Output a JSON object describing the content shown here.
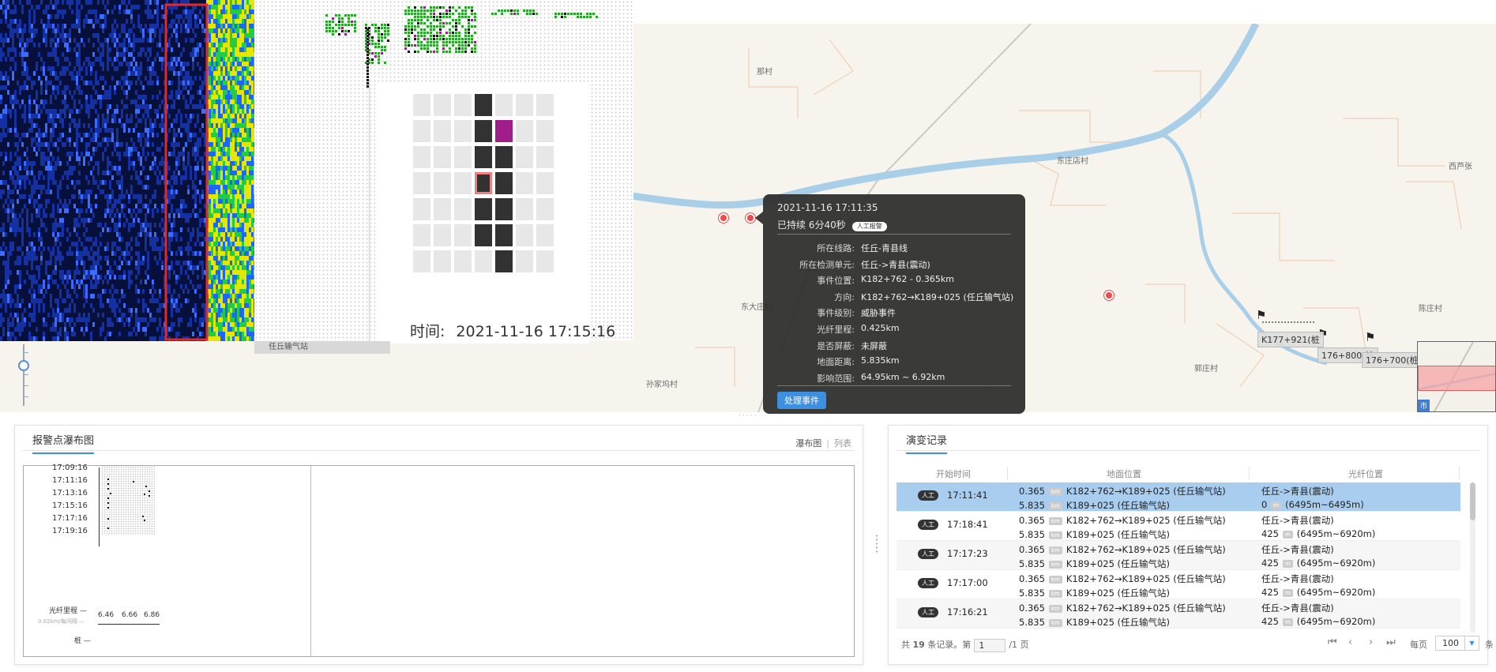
{
  "map": {
    "villages": [
      {
        "name": "那村"
      },
      {
        "name": "东庄店村"
      },
      {
        "name": "西芦张"
      },
      {
        "name": "东大庄村"
      },
      {
        "name": "陈庄村"
      },
      {
        "name": "郭庄村"
      },
      {
        "name": "孙家坞村"
      }
    ],
    "pile_labels": [
      "K177+921(桩",
      "176+800(桩",
      "176+700(桩"
    ],
    "peek_tag": "任丘输气站",
    "minimap_tag": "市",
    "zoom_in": "+",
    "zoom_out": "−",
    "colors": {
      "road": "#c8c6c1",
      "river": "#a9cfe8",
      "alarm": "#ee4b4b",
      "background": "#f7f4ee"
    }
  },
  "zoom_panel": {
    "time_label": "时间:",
    "time_value": "2021-11-16 17:15:16",
    "colors": {
      "dark": "#323232",
      "highlight": "#a01e8a",
      "selected_outline": "#f08080",
      "empty": "#e7e7e7"
    }
  },
  "popup": {
    "time": "2021-11-16 17:11:35",
    "duration": "已持续 6分40秒",
    "pill": "人工报警",
    "fields": [
      {
        "k": "所在线路:",
        "v": "任丘-青县线"
      },
      {
        "k": "所在检测单元:",
        "v": "任丘->青县(震动)"
      },
      {
        "k": "事件位置:",
        "v": "K182+762 - 0.365km"
      },
      {
        "k": "方向:",
        "v": "K182+762→K189+025 (任丘输气站)"
      },
      {
        "k": "事件级别:",
        "v": "威胁事件"
      },
      {
        "k": "光纤里程:",
        "v": "0.425km"
      },
      {
        "k": "是否屏蔽:",
        "v": "未屏蔽"
      },
      {
        "k": "地面距离:",
        "v": "5.835km"
      },
      {
        "k": "影响范围:",
        "v": "64.95km ~ 6.92km"
      }
    ],
    "button": "处理事件"
  },
  "left_panel": {
    "title": "报警点瀑布图",
    "view_waterfall": "瀑布图",
    "view_list": "列表",
    "time_ticks": [
      "17:09:16",
      "17:11:16",
      "17:13:16",
      "17:15:16",
      "17:17:16",
      "17:19:16"
    ],
    "fiber_label": "光纤里程 —",
    "fiber_unit": "0.02km/每间隔 —",
    "fiber_ticks": [
      "6.46",
      "6.66",
      "6.86"
    ],
    "base_label": "桩 —"
  },
  "right_panel": {
    "title": "演变记录",
    "columns": [
      "开始时间",
      "地面位置",
      "光纤位置"
    ],
    "rows": [
      {
        "badge": "人工",
        "time": "17:11:41",
        "g_km": "0.365",
        "g_unit": "km",
        "g_route": "K182+762→K189+025 (任丘输气站)",
        "g2_km": "5.835",
        "g2_unit": "km",
        "g2_route": "K189+025 (任丘输气站)",
        "f_unit_name": "任丘->青县(震动)",
        "f_m": "0",
        "f_unit": "m",
        "f_range": "(6495m~6495m)"
      },
      {
        "badge": "人工",
        "time": "17:18:41",
        "g_km": "0.365",
        "g_unit": "km",
        "g_route": "K182+762→K189+025 (任丘输气站)",
        "g2_km": "5.835",
        "g2_unit": "km",
        "g2_route": "K189+025 (任丘输气站)",
        "f_unit_name": "任丘->青县(震动)",
        "f_m": "425",
        "f_unit": "m",
        "f_range": "(6495m~6920m)"
      },
      {
        "badge": "人工",
        "time": "17:17:23",
        "g_km": "0.365",
        "g_unit": "km",
        "g_route": "K182+762→K189+025 (任丘输气站)",
        "g2_km": "5.835",
        "g2_unit": "km",
        "g2_route": "K189+025 (任丘输气站)",
        "f_unit_name": "任丘->青县(震动)",
        "f_m": "425",
        "f_unit": "m",
        "f_range": "(6495m~6920m)"
      },
      {
        "badge": "人工",
        "time": "17:17:00",
        "g_km": "0.365",
        "g_unit": "km",
        "g_route": "K182+762→K189+025 (任丘输气站)",
        "g2_km": "5.835",
        "g2_unit": "km",
        "g2_route": "K189+025 (任丘输气站)",
        "f_unit_name": "任丘->青县(震动)",
        "f_m": "425",
        "f_unit": "m",
        "f_range": "(6495m~6920m)"
      },
      {
        "badge": "人工",
        "time": "17:16:21",
        "g_km": "0.365",
        "g_unit": "km",
        "g_route": "K182+762→K189+025 (任丘输气站)",
        "g2_km": "5.835",
        "g2_unit": "km",
        "g2_route": "K189+025 (任丘输气站)",
        "f_unit_name": "任丘->青县(震动)",
        "f_m": "425",
        "f_unit": "m",
        "f_range": "(6495m~6920m)"
      }
    ],
    "pager": {
      "prefix": "共",
      "total": "19",
      "suffix": "条记录。第",
      "page": "1",
      "of_pages": "/1 页",
      "per_page_label": "每页",
      "per_page": "100",
      "unit": "条",
      "first": "⏮",
      "prev": "‹",
      "next": "›",
      "last": "⏭"
    }
  }
}
